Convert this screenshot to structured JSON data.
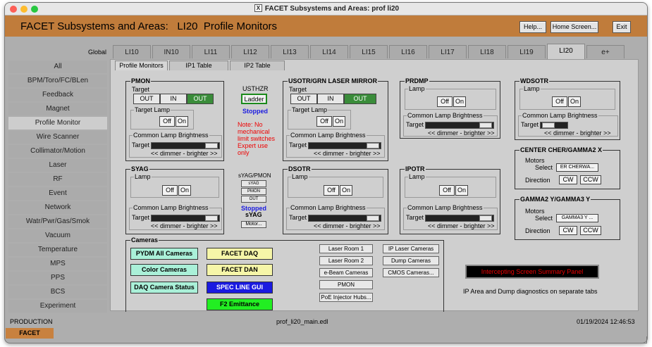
{
  "window": {
    "title": "FACET Subsystems and Areas: prof li20"
  },
  "header": {
    "title": "FACET Subsystems and Areas:   LI20  Profile Monitors",
    "help": "Help...",
    "home": "Home Screen...",
    "exit": "Exit"
  },
  "colors": {
    "header": "#c07c3b",
    "green_on": "#3a8c3a",
    "cyan": "#aaf0d8",
    "yellow": "#f6f6a8",
    "blue": "#1a1ae0",
    "green": "#22ee22",
    "red": "#ee0000"
  },
  "global_label": "Global",
  "tabs": [
    "LI10",
    "IN10",
    "LI11",
    "LI12",
    "LI13",
    "LI14",
    "LI15",
    "LI16",
    "LI17",
    "LI18",
    "LI19",
    "LI20",
    "e+"
  ],
  "selected_tab": "LI20",
  "sidebar": [
    "All",
    "BPM/Toro/FC/BLen",
    "Feedback",
    "Magnet",
    "Profile Monitor",
    "Wire Scanner",
    "Collimator/Motion",
    "Laser",
    "RF",
    "Event",
    "Network",
    "Watr/Pwr/Gas/Smok",
    "Vacuum",
    "Temperature",
    "MPS",
    "PPS",
    "BCS",
    "Experiment"
  ],
  "selected_side": "Profile Monitor",
  "subtabs": [
    "Profile Monitors",
    "IP1 Table",
    "IP2 Table"
  ],
  "common": {
    "target": "Target",
    "lamp": "Lamp",
    "target_lamp": "Target Lamp",
    "off": "Off",
    "on": "On",
    "out": "OUT",
    "in": "IN",
    "brightness": "Common Lamp Brightness",
    "dimmer": "<< dimmer - brighter >>"
  },
  "pmon": {
    "title": "PMON"
  },
  "usthzr": {
    "title": "USTHZR",
    "ladder": "Ladder",
    "status": "Stopped",
    "note": "Note: No mechanical limit switches Expert use only"
  },
  "usotr": {
    "title": "USOTR/GRN LASER MIRROR"
  },
  "prdmp": {
    "title": "PRDMP"
  },
  "wdsotr": {
    "title": "WDSOTR"
  },
  "syag": {
    "title": "SYAG"
  },
  "syag_pmon": {
    "title": "sYAG/PMON",
    "b1": "sYAG",
    "b2": "PMON",
    "b3": "OUT",
    "status1": "Stopped",
    "status2": "sYAG",
    "motor": "Motor..."
  },
  "dsotr": {
    "title": "DSOTR"
  },
  "ipotr": {
    "title": "IPOTR"
  },
  "center": {
    "title": "CENTER CHER/GAMMA2 X",
    "motors": "Motors",
    "select": "Select",
    "select_val": "ER CHERWA...",
    "direction": "Direction",
    "cw": "CW",
    "ccw": "CCW"
  },
  "gamma2": {
    "title": "GAMMA2 Y/GAMMA3 Y",
    "motors": "Motors",
    "select": "Select",
    "select_val": "GAMMA3 Y ...",
    "direction": "Direction",
    "cw": "CW",
    "ccw": "CCW"
  },
  "cameras": {
    "title": "Cameras",
    "pydm": "PYDM All Cameras",
    "color": "Color Cameras",
    "daq_status": "DAQ Camera Status",
    "facet_daq": "FACET DAQ",
    "facet_dan": "FACET DAN",
    "spec": "SPEC LINE GUI",
    "f2": "F2 Emittance",
    "laser1": "Laser Room 1",
    "laser2": "Laser Room 2",
    "ebeam": "e-Beam Cameras",
    "pmon": "PMON",
    "poe": "PoE Injector Hubs...",
    "ip_laser": "IP Laser Cameras",
    "dump": "Dump Cameras",
    "cmos": "CMOS Cameras..."
  },
  "summary": {
    "button": "Intercepting Screen Summary Panel",
    "note": "IP Area and Dump diagnostics on separate tabs"
  },
  "status": {
    "mode": "PRODUCTION",
    "file": "prof_li20_main.edl",
    "time": "01/19/2024 12:46:53",
    "facet": "FACET"
  }
}
